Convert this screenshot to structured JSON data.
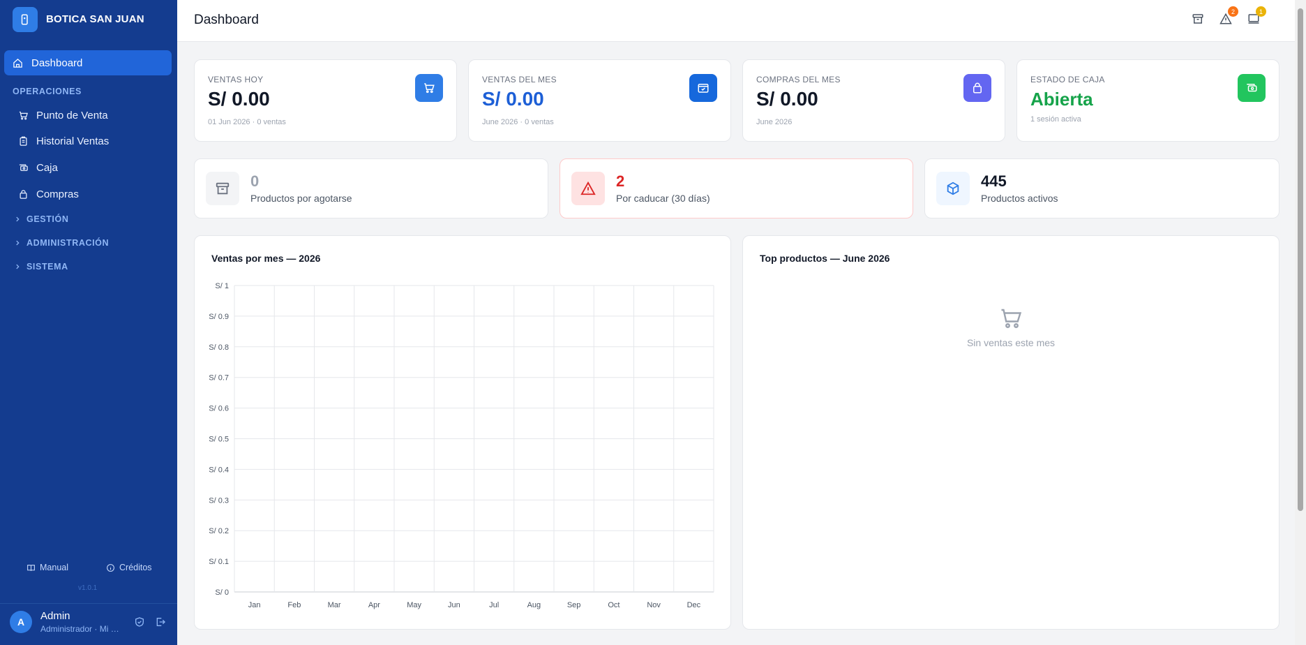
{
  "app": {
    "name": "BOTICA SAN JUAN"
  },
  "sidebar": {
    "active": {
      "label": "Dashboard",
      "icon": "home-icon"
    },
    "section_operaciones": "OPERACIONES",
    "items": [
      {
        "label": "Punto de Venta",
        "icon": "cart-icon"
      },
      {
        "label": "Historial Ventas",
        "icon": "clipboard-icon"
      },
      {
        "label": "Caja",
        "icon": "cash-icon"
      },
      {
        "label": "Compras",
        "icon": "bag-icon"
      }
    ],
    "groups": [
      "GESTIÓN",
      "ADMINISTRACIÓN",
      "SISTEMA"
    ],
    "footer": {
      "manual": "Manual",
      "creditos": "Créditos",
      "version": "v1.0.1"
    },
    "user": {
      "initial": "A",
      "name": "Admin",
      "role": "Administrador · Mi Botica"
    }
  },
  "header": {
    "title": "Dashboard",
    "icons": [
      "archive-icon",
      "alert-icon",
      "monitor-icon"
    ],
    "alert_badge": "2",
    "monitor_badge": "1"
  },
  "stats": [
    {
      "label": "VENTAS HOY",
      "value": "S/ 0.00",
      "sub": "01 Jun 2026 · 0 ventas",
      "color": "#111827",
      "icon_bg": "#2f7de6"
    },
    {
      "label": "VENTAS DEL MES",
      "value": "S/ 0.00",
      "sub": "June 2026 · 0 ventas",
      "color": "#1d5fd6",
      "icon_bg": "#1668dc"
    },
    {
      "label": "COMPRAS DEL MES",
      "value": "S/ 0.00",
      "sub": "June 2026",
      "color": "#111827",
      "icon_bg": "#6366f1"
    },
    {
      "label": "ESTADO DE CAJA",
      "value": "Abierta",
      "sub": "1 sesión activa",
      "color": "#16a34a",
      "icon_bg": "#22c55e"
    }
  ],
  "mini": [
    {
      "value": "0",
      "label": "Productos por agotarse"
    },
    {
      "value": "2",
      "label": "Por caducar (30 días)"
    },
    {
      "value": "445",
      "label": "Productos activos"
    }
  ],
  "sales_panel": {
    "title": "Ventas por mes — 2026"
  },
  "top_panel": {
    "title": "Top productos — June 2026",
    "empty_text": "Sin ventas este mes"
  },
  "chart_data": {
    "type": "bar",
    "categories": [
      "Jan",
      "Feb",
      "Mar",
      "Apr",
      "May",
      "Jun",
      "Jul",
      "Aug",
      "Sep",
      "Oct",
      "Nov",
      "Dec"
    ],
    "values": [
      0,
      0,
      0,
      0,
      0,
      0,
      0,
      0,
      0,
      0,
      0,
      0
    ],
    "ylim": [
      0,
      1
    ],
    "yticks": [
      "S/ 0",
      "S/ 0.1",
      "S/ 0.2",
      "S/ 0.3",
      "S/ 0.4",
      "S/ 0.5",
      "S/ 0.6",
      "S/ 0.7",
      "S/ 0.8",
      "S/ 0.9",
      "S/ 1"
    ],
    "grid": true
  }
}
